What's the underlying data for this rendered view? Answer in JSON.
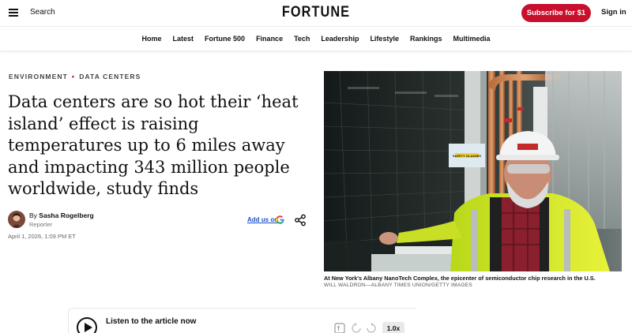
{
  "header": {
    "search_label": "Search",
    "logo_text": "FORTUNE",
    "subscribe_label": "Subscribe for $1",
    "signin_label": "Sign in"
  },
  "nav": {
    "items": [
      "Home",
      "Latest",
      "Fortune 500",
      "Finance",
      "Tech",
      "Leadership",
      "Lifestyle",
      "Rankings",
      "Multimedia"
    ]
  },
  "article": {
    "kicker": [
      "ENVIRONMENT",
      "DATA CENTERS"
    ],
    "kicker_separator": "•",
    "headline": "Data centers are so hot their ‘heat island’ effect is raising temperatures up to 6 miles away and impacting 343 million people worldwide, study finds",
    "byline_prefix": "By",
    "author_name": "Sasha Rogelberg",
    "author_role": "Reporter",
    "add_us_label": "Add us on",
    "date": "April 1, 2026, 1:09 PM ET"
  },
  "image": {
    "caption": "At New York's Albany NanoTech Complex, the epicenter of semiconductor chip research in the U.S.",
    "credit": "WILL WALDRON—ALBANY TIMES UNION/GETTY IMAGES",
    "sign_text": "SAFETY GLASSES"
  },
  "audio": {
    "listen_label": "Listen to the article now",
    "speed": "1.0x"
  },
  "colors": {
    "brand_red": "#c8102e",
    "link_blue": "#1a4fc8"
  }
}
